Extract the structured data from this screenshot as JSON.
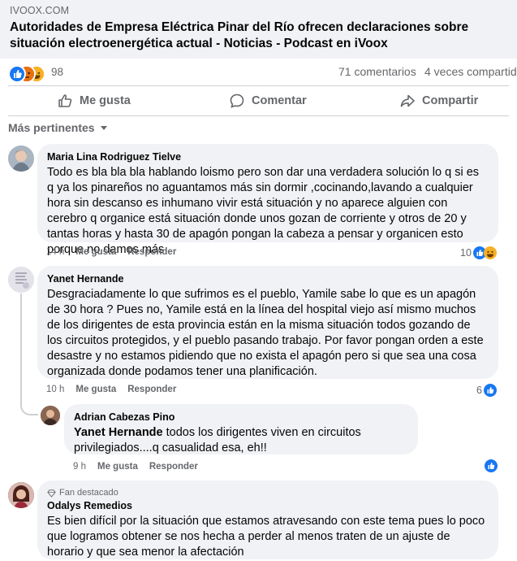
{
  "post": {
    "link_domain": "IVOOX.COM",
    "link_title": "Autoridades de Empresa Eléctrica Pinar del Río ofrecen declaraciones sobre situación electroenergética actual - Noticias - Podcast en iVoox",
    "reaction_count": "98",
    "comments_count": "71 comentarios",
    "shares_count": "4 veces compartido"
  },
  "actions": {
    "like": "Me gusta",
    "comment": "Comentar",
    "share": "Compartir"
  },
  "sort_label": "Más pertinentes",
  "comments": [
    {
      "author": "Maria Lina Rodriguez Tielve",
      "text": "Todo es bla bla bla hablando loismo pero son dar una verdadera solución lo q si es q ya los pinareños no aguantamos más sin dormir ,cocinando,lavando a cualquier hora sin descanso es inhumano vivir está situación y no aparece alguien con cerebro q organice está situación donde unos gozan de corriente y otros de 20 y tantas horas y hasta 30 de apagón pongan la cabeza a pensar y organicen esto porque no damos más",
      "time": "14 h",
      "like": "Me gusta",
      "reply": "Responder",
      "reactions": "10"
    },
    {
      "author": "Yanet Hernande",
      "text": "Desgraciadamente lo que sufrimos es el pueblo, Yamile sabe lo que es un apagón de 30 hora ? Pues no, Yamile está en la línea del hospital viejo así mismo muchos de los dirigentes de esta provincia están en la misma situación todos gozando de los circuitos protegidos, y el pueblo pasando trabajo. Por favor pongan orden a este desastre y no estamos pidiendo que no exista el apagón pero si que sea una cosa organizada donde podamos tener una planificación.",
      "time": "10 h",
      "like": "Me gusta",
      "reply": "Responder",
      "reactions": "6"
    },
    {
      "author": "Adrian Cabezas Pino",
      "mention": "Yanet Hernande",
      "text": " todos los dirigentes viven en circuitos privilegiados....q casualidad esa, eh!!",
      "time": "9 h",
      "like": "Me gusta",
      "reply": "Responder"
    },
    {
      "badge": "Fan destacado",
      "author": "Odalys Remedios",
      "text": "Es bien difícil por la situación que estamos atravesando con este tema pues lo poco que logramos obtener se nos hecha a perder al menos traten de un ajuste de horario y que sea menor la afectación"
    }
  ],
  "colors": {
    "accent": "#1877f2",
    "secondary_text": "#65676b",
    "bubble": "#f0f2f5"
  },
  "icons": [
    "like-icon",
    "love-icon",
    "haha-icon",
    "angry-icon",
    "thumbs-up-outline-icon",
    "comment-bubble-icon",
    "share-arrow-icon",
    "caret-down-icon",
    "diamond-icon"
  ]
}
